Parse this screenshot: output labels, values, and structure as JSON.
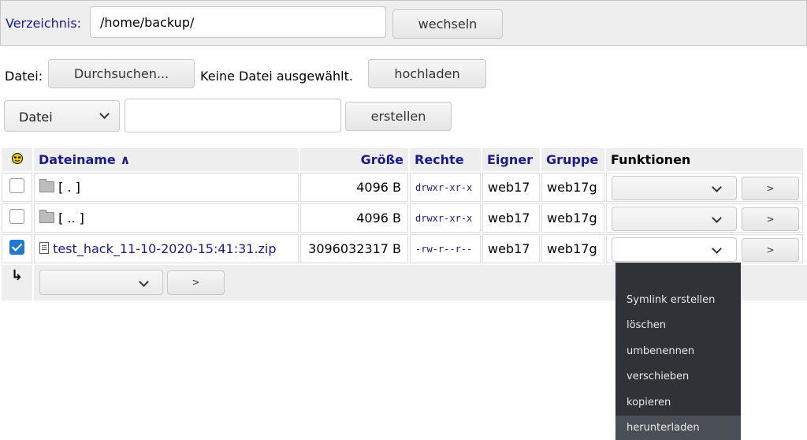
{
  "directory": {
    "label": "Verzeichnis:",
    "path": "/home/backup/",
    "change_button": "wechseln"
  },
  "upload": {
    "label": "Datei:",
    "browse_button": "Durchsuchen...",
    "status": "Keine Datei ausgewählt.",
    "upload_button": "hochladen"
  },
  "create": {
    "type_selected": "Datei",
    "name_value": "",
    "create_button": "erstellen"
  },
  "table": {
    "header_icon": "smiley-icon",
    "columns": {
      "name": "Dateiname ∧",
      "size": "Größe",
      "perms": "Rechte",
      "owner": "Eigner",
      "group": "Gruppe",
      "functions": "Funktionen"
    },
    "rows": [
      {
        "checked": false,
        "icon": "folder-icon",
        "name": "[ . ]",
        "size": "4096 B",
        "perms": "drwxr-xr-x",
        "owner": "web17",
        "group": "web17g",
        "go": ">"
      },
      {
        "checked": false,
        "icon": "folder-icon",
        "name": "[ .. ]",
        "size": "4096 B",
        "perms": "drwxr-xr-x",
        "owner": "web17",
        "group": "web17g",
        "go": ">"
      },
      {
        "checked": true,
        "icon": "file-icon",
        "name": "test_hack_11-10-2020-15:41:31.zip",
        "size": "3096032317 B",
        "perms": "-rw-r--r--",
        "owner": "web17",
        "group": "web17g",
        "go": ">"
      }
    ],
    "bulk_arrow": "↳",
    "bulk_go": ">"
  },
  "function_menu": {
    "items": [
      "Symlink erstellen",
      "löschen",
      "umbenennen",
      "verschieben",
      "kopieren",
      "herunterladen"
    ],
    "highlighted": "herunterladen"
  },
  "colors": {
    "link": "#1a1a8c",
    "menu_bg": "#2f3237",
    "checkbox": "#1e78d4"
  }
}
